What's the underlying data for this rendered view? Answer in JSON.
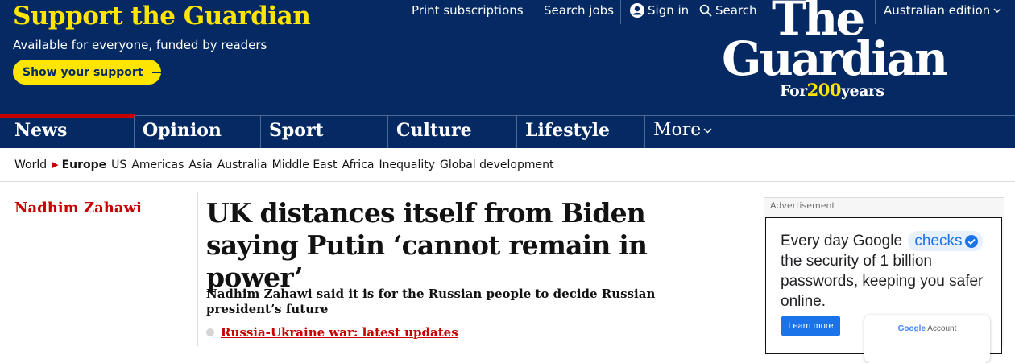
{
  "support": {
    "title": "Support the Guardian",
    "subtitle": "Available for everyone, funded by readers",
    "button_label": "Show your support"
  },
  "utility": {
    "print": "Print subscriptions",
    "jobs": "Search jobs",
    "signin": "Sign in",
    "search": "Search",
    "edition": "Australian edition"
  },
  "logo": {
    "line1": "The",
    "line2": "Guardian",
    "tag_pre": "For",
    "tag_num": "200",
    "tag_post": "years"
  },
  "pillars": {
    "news": "News",
    "opinion": "Opinion",
    "sport": "Sport",
    "culture": "Culture",
    "lifestyle": "Lifestyle",
    "more": "More"
  },
  "subnav": {
    "world": "World",
    "europe": "Europe",
    "us": "US",
    "americas": "Americas",
    "asia": "Asia",
    "australia": "Australia",
    "middle_east": "Middle East",
    "africa": "Africa",
    "inequality": "Inequality",
    "global_development": "Global development"
  },
  "article": {
    "kicker": "Nadhim Zahawi",
    "headline": "UK distances itself from Biden saying Putin ‘cannot remain in power’",
    "standfirst": "Nadhim Zahawi said it is for the Russian people to decide Russian president’s future",
    "live_link": "Russia-Ukraine war: latest updates"
  },
  "ad": {
    "label": "Advertisement",
    "text_pre": "Every day Google",
    "text_checks": "checks",
    "text_post": "the security of 1 billion passwords, keeping you safer online.",
    "button": "Learn more",
    "account_google": "Google",
    "account_word": "Account"
  },
  "colors": {
    "brand_blue": "#052962",
    "support_yellow": "#ffe500",
    "news_red": "#c70000",
    "google_blue": "#1a73e8"
  }
}
